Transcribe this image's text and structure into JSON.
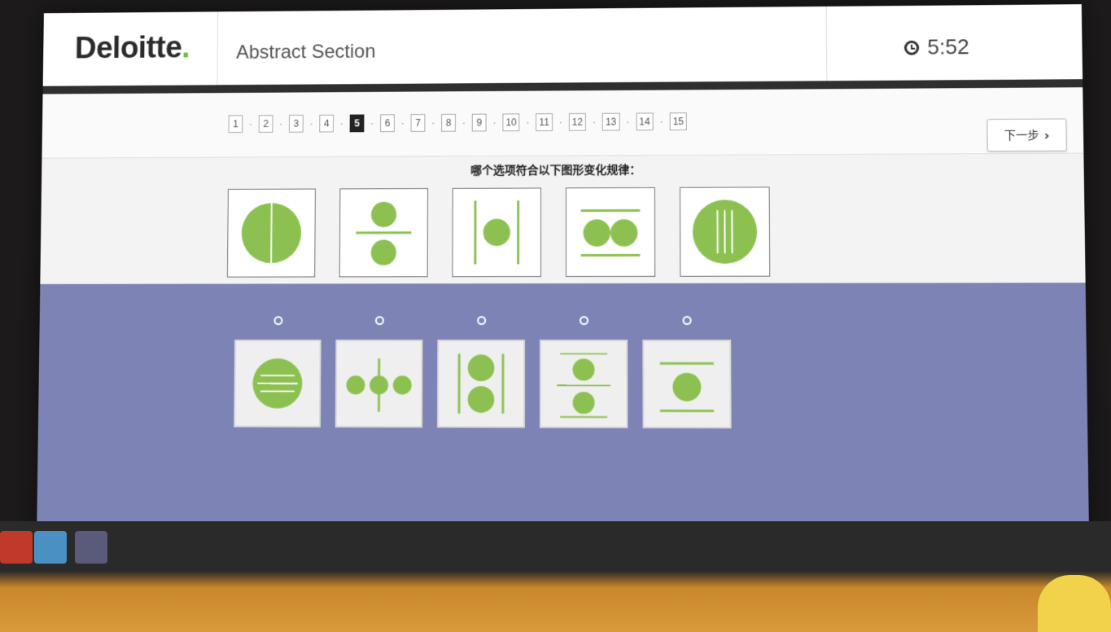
{
  "header": {
    "logo": "Deloitte",
    "logo_dot": ".",
    "section_title": "Abstract Section",
    "timer": "5:52"
  },
  "pager": {
    "pages": [
      "1",
      "2",
      "3",
      "4",
      "5",
      "6",
      "7",
      "8",
      "9",
      "10",
      "11",
      "12",
      "13",
      "14",
      "15"
    ],
    "current": "5",
    "separator": "·"
  },
  "next_button": {
    "label": "下一步",
    "icon": "chevron-right-icon"
  },
  "question": "哪个选项符合以下图形变化规律：",
  "colors": {
    "shape_green": "#8cc152",
    "answer_band": "#7d83b4",
    "logo_dot": "#6dbd3d"
  }
}
